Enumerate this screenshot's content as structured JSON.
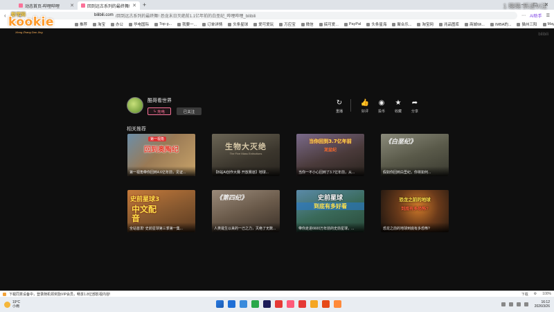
{
  "browser": {
    "tabs": [
      {
        "label": "动态首页-哔哩哔哩",
        "active": false
      },
      {
        "label": "回到远古系列的最终舞! 恐...",
        "active": true
      }
    ],
    "new_tab": "+",
    "window_controls": [
      "—",
      "☐",
      "✕"
    ],
    "url_host": "bilibili.com",
    "url_path": "/回到远古系列的最终舞! 恐龙末日灭绝前1.1亿年前的白垩纪_哔哩哔哩_bilibili",
    "ai_label": "AI助手",
    "bookmarks": [
      "推荐",
      "淘宝",
      "办公",
      "华电国际",
      "Top g...",
      "我要一...",
      "订单详情",
      "头条星球",
      "爱可爱玩",
      "万应宝",
      "微信",
      "搞可爱...",
      "PayPal",
      "头条星海",
      "聚合乐...",
      "淘宝网",
      "兆品图库",
      "商城Wi...",
      "IMBA的...",
      "猫州三阳",
      "Maybe",
      "游戏主..."
    ]
  },
  "overlay": {
    "logo_sub": "新学网",
    "logo_text": "kookie",
    "logo_tag": "Xiong Zhang Dao Jing",
    "watermark": "1 晓晓·拆进Vi注",
    "bili_mark": "bilibili"
  },
  "uploader": {
    "name": "酷哥看世界",
    "charge_label": "充电",
    "follow_label": "已关注"
  },
  "actions": [
    {
      "icon": "replay-icon",
      "glyph": "↻",
      "label": "重播"
    },
    {
      "icon": "like-icon",
      "glyph": "👍",
      "label": "好评"
    },
    {
      "icon": "coin-icon",
      "glyph": "◉",
      "label": "投币"
    },
    {
      "icon": "star-icon",
      "glyph": "★",
      "label": "收藏"
    },
    {
      "icon": "share-icon",
      "glyph": "➦",
      "label": "分享"
    }
  ],
  "recommend": {
    "title": "相关推荐",
    "cards": [
      {
        "thumb_title": "回到奥陶纪",
        "thumb_tag": "第一视角",
        "thumb_sub": "",
        "caption": "第一视角带你回到4.6亿年前，见证..."
      },
      {
        "thumb_title": "生物大灭绝",
        "thumb_tag": "",
        "thumb_sub": "The Five Mass Extinctions",
        "caption": "【B站AI创作大赛·开放赛道】地球..."
      },
      {
        "thumb_title": "当你回到3.7亿年前",
        "thumb_tag": "",
        "thumb_sub": "泥盆纪",
        "caption": "当你一不小心回到了3.7亿年前，从..."
      },
      {
        "thumb_title": "《白垩纪》",
        "thumb_tag": "",
        "thumb_sub": "",
        "caption": "假如你回到白垩纪，你将如何..."
      },
      {
        "thumb_title": "史前星球3",
        "thumb_tag": "",
        "thumb_sub": "中文配音",
        "caption": "全站首发! 史前星球第三季第一集..."
      },
      {
        "thumb_title": "《第四纪》",
        "thumb_tag": "",
        "thumb_sub": "",
        "caption": "人类诞生以来的一己之力，灭绝了无数..."
      },
      {
        "thumb_title": "史前星球",
        "thumb_tag": "",
        "thumb_sub": "到底有多好看",
        "caption": "带你走进6600万年前的史前星球，..."
      },
      {
        "thumb_title": "恐龙之前的地球",
        "thumb_tag": "",
        "thumb_sub": "到底有多恐怖?",
        "caption": "恐龙之前的地球到底有多恐怖?"
      }
    ]
  },
  "statusbar": {
    "message": "下载同意设备中，登录随机领奖励VIP会员，畅享1.8亿部影视内容!",
    "right": [
      "下载",
      "⚙",
      "100%"
    ]
  },
  "taskbar": {
    "temp": "19°C",
    "weather": "小雨",
    "time": "16:12",
    "date": "2026/3/26",
    "icon_colors": [
      "#1f6fd6",
      "#3a8bdc",
      "#2aa84a",
      "#1d1d5a",
      "#e53935",
      "#ff5a7a",
      "#e53935",
      "#f5a623",
      "#e64a19",
      "#ff8a3a"
    ]
  }
}
